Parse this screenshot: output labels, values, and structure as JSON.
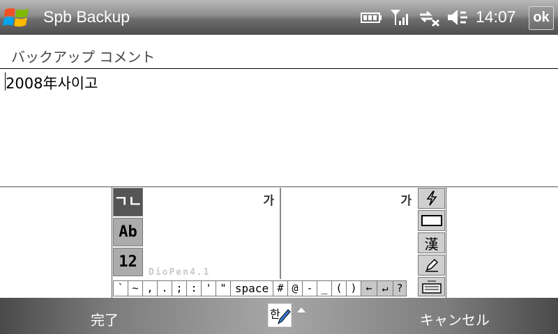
{
  "titlebar": {
    "app_title": "Spb Backup",
    "clock": "14:07",
    "ok_label": "ok",
    "icons": [
      "windows-start-icon",
      "battery-icon",
      "signal-icon",
      "data-sync-icon",
      "speaker-icon"
    ]
  },
  "form": {
    "field_label": "バックアップ コメント",
    "comment_value": "2008年사이고"
  },
  "ime": {
    "mode_buttons": [
      "ㄱㄴ",
      "Ab",
      "12"
    ],
    "pad_glyph": "가",
    "brand": "DioPen4.1",
    "side_icons": [
      "lightning-icon",
      "blank-key-icon",
      "kanji-icon",
      "pen-icon",
      "keyboard-icon"
    ],
    "side_kanji": "漢",
    "keys": [
      "`",
      "~",
      ",",
      ".",
      ";",
      ":",
      "'",
      "\"",
      "space",
      "#",
      "@",
      "-",
      "_",
      "(",
      ")",
      "←",
      "↵",
      "?"
    ]
  },
  "softkeys": {
    "left": "完了",
    "right": "キャンセル"
  },
  "colors": {
    "titlebar_gray": "#6e6e6e",
    "softbar_gray": "#7d7d7d",
    "text": "#000000"
  }
}
